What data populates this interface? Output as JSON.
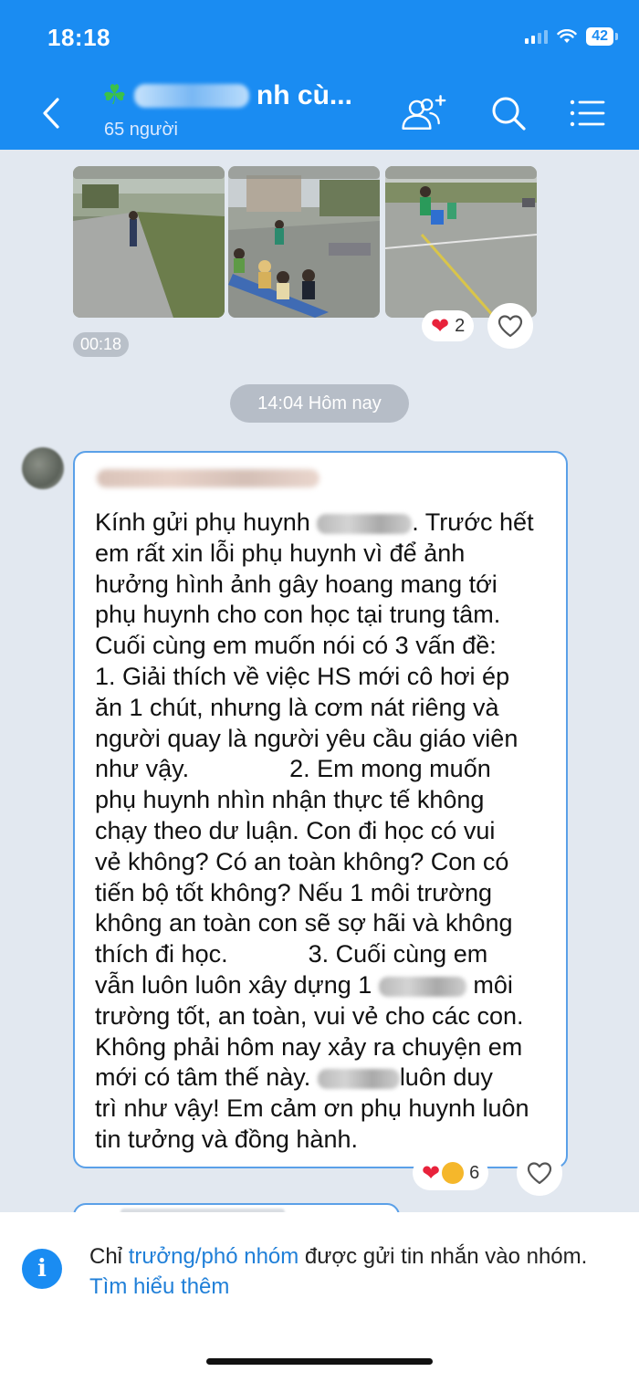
{
  "status_bar": {
    "time": "18:18",
    "battery": "42"
  },
  "header": {
    "title_visible": "nh cù...",
    "member_count": "65 người",
    "icons": [
      "back-icon",
      "clover-icon",
      "add-member-icon",
      "search-icon",
      "menu-icon"
    ]
  },
  "media": {
    "duration": "00:18",
    "reaction_count": "2"
  },
  "date_separator": "14:04 Hôm nay",
  "message": {
    "lines": [
      "Kính gửi phụ huynh",
      ". Trước hết",
      "em rất xin lỗi phụ huynh vì để ảnh",
      "hưởng hình ảnh gây hoang mang tới",
      "phụ huynh cho con học tại trung tâm.",
      "Cuối cùng em muốn nói có 3 vấn đề:",
      "1. Giải thích về việc HS mới cô hơi ép",
      "ăn 1 chút, nhưng là cơm nát riêng và",
      "người quay là người yêu cầu giáo viên",
      "như vậy.",
      "2. Em mong muốn",
      "phụ huynh nhìn nhận thực tế không",
      "chạy theo dư luận. Con đi học có vui",
      "vẻ không? Có an toàn không? Con có",
      "tiến bộ tốt không? Nếu 1 môi trường",
      "không an toàn con sẽ sợ hãi và không",
      "thích đi học.",
      "3. Cuối cùng em",
      "vẫn luôn luôn xây dựng 1",
      "môi",
      "trường tốt, an toàn, vui vẻ cho các con.",
      "Không phải hôm nay xảy ra chuyện em",
      "mới có tâm thế này.",
      "luôn duy",
      "trì như vậy! Em cảm ơn phụ huynh luôn",
      "tin tưởng và đồng hành."
    ],
    "reaction_count": "6"
  },
  "info_panel": {
    "prefix": "Chỉ ",
    "link_roles": "trưởng/phó nhóm",
    "suffix": " được gửi tin nhắn vào nhóm.",
    "link_more": "Tìm hiểu thêm"
  },
  "colors": {
    "header_bg": "#1a8cf2",
    "chat_bg": "#e2e8f0",
    "bubble_border": "#5aa0e8",
    "link": "#1f7fd8"
  }
}
